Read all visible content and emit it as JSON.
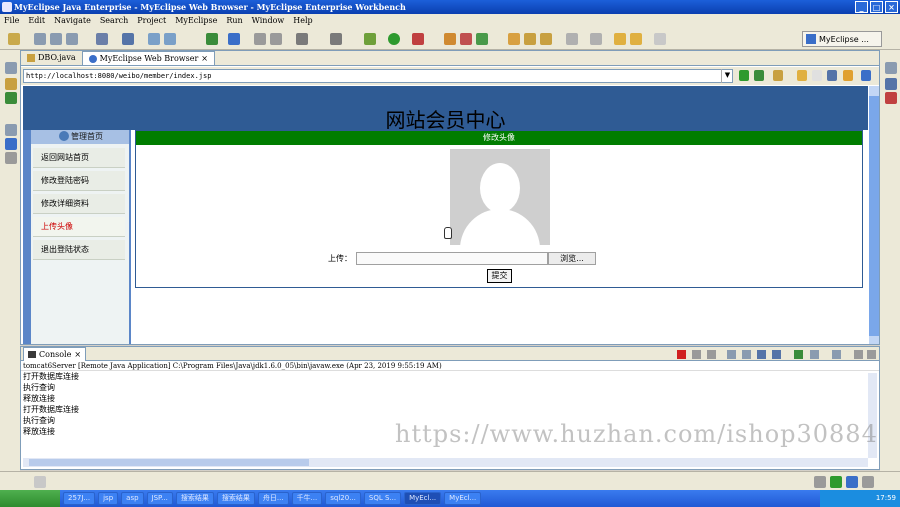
{
  "window": {
    "title": "MyEclipse Java Enterprise - MyEclipse Web Browser - MyEclipse Enterprise Workbench",
    "controls": [
      "_",
      "□",
      "×"
    ]
  },
  "menu": [
    "File",
    "Edit",
    "Navigate",
    "Search",
    "Project",
    "MyEclipse",
    "Run",
    "Window",
    "Help"
  ],
  "perspective": "MyEclipse ...",
  "editor_tabs": [
    {
      "label": "DBO.java",
      "close": ""
    },
    {
      "label": "MyEclipse Web Browser",
      "close": "×"
    }
  ],
  "browser": {
    "url": "http://localhost:8080/weibo/member/index.jsp",
    "dropdown": "▼"
  },
  "webpage": {
    "title": "网站会员中心",
    "sidebar_header": "管理首页",
    "sidebar_items": [
      "返回网站首页",
      "修改登陆密码",
      "修改详细资料",
      "上传头像",
      "退出登陆状态"
    ],
    "section_title": "修改头像",
    "upload_label": "上传：",
    "browse_label": "浏览...",
    "submit_label": "提交"
  },
  "console": {
    "tab_label": "Console",
    "tab_close": "×",
    "process": "tomcat6Server [Remote Java Application] C:\\Program Files\\Java\\jdk1.6.0_05\\bin\\javaw.exe (Apr 23, 2019 9:55:19 AM)",
    "lines": [
      "打开数据库连接",
      "执行查询",
      "释放连接",
      "打开数据库连接",
      "执行查询",
      "释放连接"
    ]
  },
  "watermark": "https://www.huzhan.com/ishop30884",
  "taskbar": {
    "items": [
      "257J...",
      "jsp",
      "asp",
      "JSP...",
      "搜索结果",
      "搜索结果",
      "舟日...",
      "千牛...",
      "sql20...",
      "SQL S...",
      "MyEcl...",
      "MyEcl..."
    ],
    "clock": "17:59"
  },
  "colors": {
    "header": "#2f5b94",
    "section_bar": "#007d00",
    "active_item": "#cc0000"
  }
}
